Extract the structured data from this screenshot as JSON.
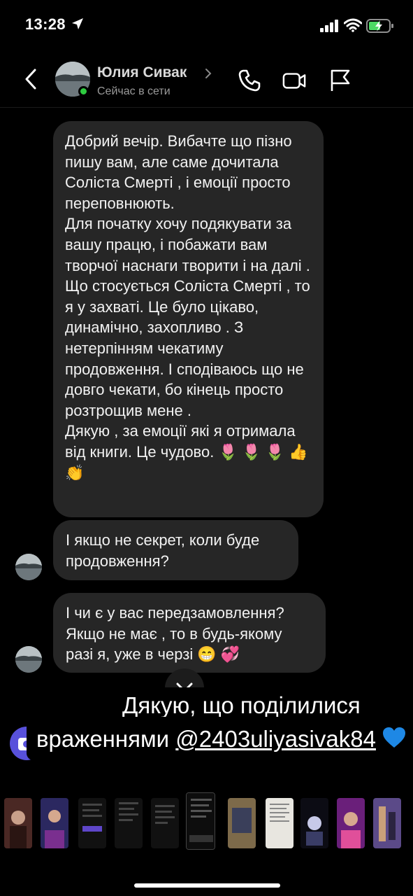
{
  "status_bar": {
    "time": "13:28"
  },
  "header": {
    "name": "Юлия Сивак",
    "presence": "Сейчас в сети"
  },
  "messages": [
    {
      "paragraphs": [
        "Добрий вечір. Вибачте що пізно пишу вам, але саме дочитала Соліста Смерті , і емоції просто переповнюють.",
        "Для початку хочу подякувати за вашу працю, і побажати вам творчої наснаги творити і на далі .",
        "Що стосується Соліста Смерті , то я у захваті. Це було цікаво, динамічно, захопливо . З нетерпінням чекатиму продовження. І сподіваюсь що не довго чекати, бо кінець просто розтрощив мене .",
        "Дякую , за емоції які я отримала від книги. Це чудово. 🌷 🌷 🌷 👍👏"
      ]
    },
    {
      "text": "І якщо не секрет, коли буде продовження?"
    },
    {
      "text": "І чи є у вас передзамовлення? Якщо не має , то в будь-якому разі я, уже в черзі 😁 💞"
    }
  ],
  "caption": {
    "line1": "Дякую, що поділилися",
    "line2_prefix": "враженнями",
    "mention": "@2403uliyasivak84"
  },
  "colors": {
    "background": "#000000",
    "bubble": "#262626",
    "online": "#2ecc40",
    "heart": "#1e88e5"
  },
  "icons": [
    "location-arrow-icon",
    "signal-icon",
    "wifi-icon",
    "battery-charging-icon",
    "back-chevron-icon",
    "phone-icon",
    "video-icon",
    "flag-icon",
    "chevron-down-icon",
    "camera-icon",
    "blue-heart-icon"
  ]
}
